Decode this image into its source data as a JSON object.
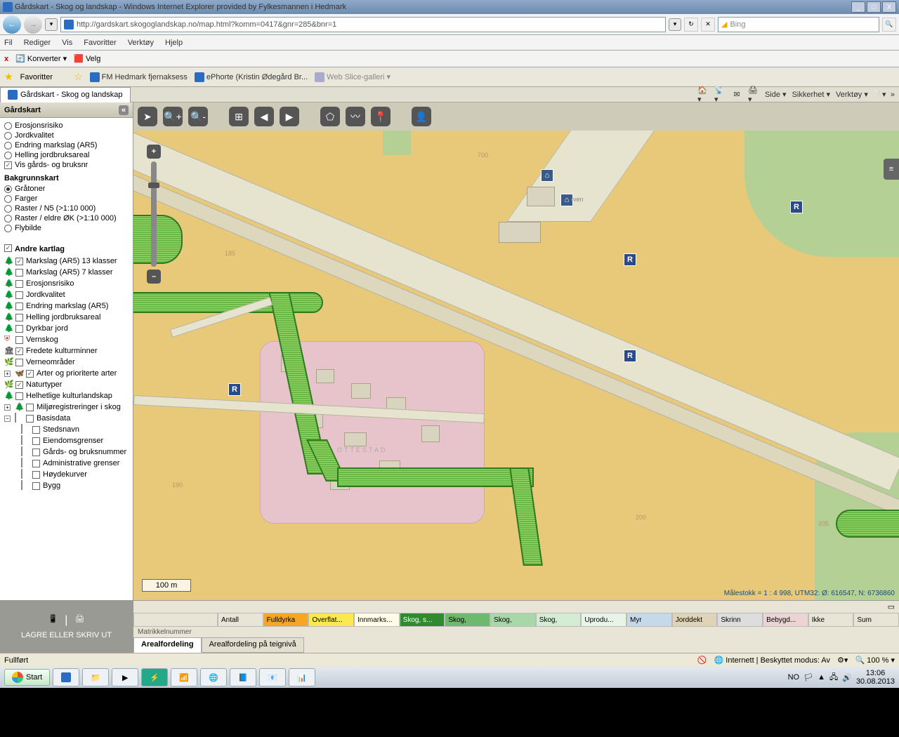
{
  "window": {
    "title": "Gårdskart - Skog og landskap - Windows Internet Explorer provided by Fylkesmannen i Hedmark",
    "min": "_",
    "max": "□",
    "close": "X"
  },
  "addressbar": {
    "url": "http://gardskart.skogoglandskap.no/map.html?komm=0417&gnr=285&bnr=1",
    "search_placeholder": "Bing",
    "search_icon": "🔍"
  },
  "menus": {
    "fil": "Fil",
    "rediger": "Rediger",
    "vis": "Vis",
    "favoritter": "Favoritter",
    "verktoy": "Verktøy",
    "hjelp": "Hjelp"
  },
  "convbar": {
    "konverter": "Konverter",
    "velg": "Velg"
  },
  "favbar": {
    "favoritter": "Favoritter",
    "link1": "FM Hedmark fjernaksess",
    "link2": "ePhorte (Kristin Ødegård Br...",
    "link3": "Web Slice-galleri"
  },
  "tab": {
    "title": "Gårdskart - Skog og landskap"
  },
  "tabright": {
    "side": "Side",
    "sikkerhet": "Sikkerhet",
    "verktoy": "Verktøy"
  },
  "sidebar": {
    "title": "Gårdskart",
    "toggle": "«",
    "opts": {
      "erosjon": "Erosjonsrisiko",
      "jordkvalitet": "Jordkvalitet",
      "endring": "Endring markslag (AR5)",
      "helling": "Helling jordbruksareal",
      "visgards": "Vis gårds- og bruksnr"
    },
    "bakgrunn": {
      "title": "Bakgrunnskart",
      "gratoner": "Gråtoner",
      "farger": "Farger",
      "raster": "Raster / N5 (>1:10 000)",
      "rasterok": "Raster / eldre ØK (>1:10 000)",
      "flybilde": "Flybilde"
    },
    "andre": {
      "title": "Andre kartlag",
      "m13": "Markslag (AR5) 13 klasser",
      "m7": "Markslag (AR5) 7 klasser",
      "eros": "Erosjonsrisiko",
      "jord": "Jordkvalitet",
      "endr": "Endring markslag (AR5)",
      "hell": "Helling jordbruksareal",
      "dyrk": "Dyrkbar jord",
      "vern": "Vernskog",
      "fred": "Fredete kulturminner",
      "verno": "Verneområder",
      "arter": "Arter og prioriterte arter",
      "natur": "Naturtyper",
      "helh": "Helhetlige kulturlandskap",
      "miljo": "Miljøregistreringer i skog",
      "basis": "Basisdata",
      "steds": "Stedsnavn",
      "eien": "Eiendomsgrenser",
      "gards": "Gårds- og bruksnummer",
      "admin": "Administrative grenser",
      "hoyde": "Høydekurver",
      "bygg": "Bygg"
    },
    "footer": "LAGRE ELLER SKRIV UT"
  },
  "map": {
    "scale": "100 m",
    "coords": "Målestokk = 1 : 4 998, UTM32: Ø: 616547, N: 6736860",
    "zplus": "+",
    "zminus": "–",
    "markers": {
      "r": "R"
    },
    "elev1": "700",
    "elev2": "185",
    "elev3": "190",
    "elev4": "200",
    "elev5": "205",
    "place": "OTTESTAD",
    "place2": "rven"
  },
  "legend": {
    "antall": "Antall",
    "fulldyrka": "Fulldyrka",
    "overflat": "Overflat...",
    "innmark": "Innmarks...",
    "skoga": "Skog, s...",
    "skog2": "Skog,",
    "skog3": "Skog,",
    "skog4": "Skog,",
    "uprodu": "Uprodu...",
    "myr": "Myr",
    "jorddekt": "Jorddekt",
    "skrinn": "Skrinn",
    "bebygd": "Bebygd...",
    "ikke": "Ikke",
    "sum": "Sum"
  },
  "mattabs": {
    "label": "Matrikkelnummer",
    "areal": "Arealfordeling",
    "teignivaa": "Arealfordeling på teignivå"
  },
  "status": {
    "left": "Fullført",
    "internett": "Internett | Beskyttet modus: Av",
    "zoom": "100 %"
  },
  "taskbar": {
    "start": "Start",
    "no": "NO",
    "time": "13:06",
    "date": "30.08.2013"
  }
}
